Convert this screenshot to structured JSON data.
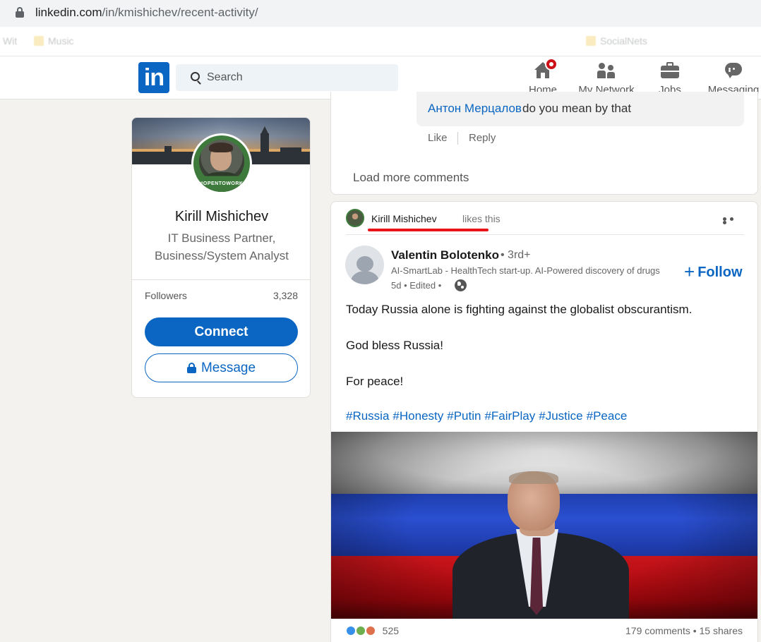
{
  "browser": {
    "url_domain": "linkedin.com",
    "url_path": "/in/kmishichev/recent-activity/",
    "bookmarks": [
      "Wit",
      "Music",
      "SocialNets"
    ]
  },
  "nav": {
    "logo_text": "in",
    "search_placeholder": "Search",
    "items": [
      {
        "label": "Home",
        "icon": "home-icon"
      },
      {
        "label": "My Network",
        "icon": "network-icon"
      },
      {
        "label": "Jobs",
        "icon": "jobs-icon"
      },
      {
        "label": "Messaging",
        "icon": "messaging-icon"
      }
    ]
  },
  "profile": {
    "name": "Kirill Mishichev",
    "headline": "IT Business Partner, Business/System Analyst",
    "open_to_work_badge": "#OPENTOWORK",
    "followers_label": "Followers",
    "followers_count": "3,328",
    "connect_label": "Connect",
    "message_label": "Message"
  },
  "comment": {
    "author": "Антон Мерцалов",
    "text": "do you mean by that",
    "like_label": "Like",
    "reply_label": "Reply",
    "load_more_label": "Load more comments"
  },
  "post": {
    "liker_name": "Kirill Mishichev",
    "liker_action": "likes this",
    "author_name": "Valentin Bolotenko",
    "author_degree": "• 3rd+",
    "author_title": "AI-SmartLab - HealthTech start-up. AI-Powered discovery of drugs",
    "time_text": "5d • Edited •",
    "follow_label": "Follow",
    "body_lines": [
      "Today Russia alone is fighting against the globalist obscurantism.",
      "God bless Russia!",
      "For peace!"
    ],
    "hashtags": [
      "#Russia",
      "#Honesty",
      "#Putin",
      "#FairPlay",
      "#Justice",
      "#Peace"
    ],
    "reactions_count": "525",
    "stats_text": "179 comments • 15 shares"
  },
  "colors": {
    "brand": "#0a66c2",
    "badge": "#cc1016",
    "underline": "#e8141a"
  }
}
